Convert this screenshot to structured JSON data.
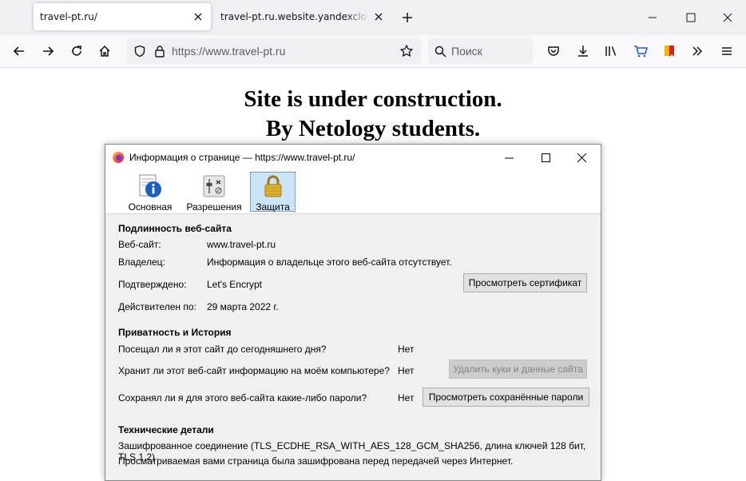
{
  "browser": {
    "tabs": [
      {
        "title": "travel-pt.ru/"
      },
      {
        "title": "travel-pt.ru.website.yandexcloud.net"
      }
    ],
    "url": "https://www.travel-pt.ru",
    "search_placeholder": "Поиск"
  },
  "page": {
    "line1": "Site is under construction.",
    "line2": "By Netology students."
  },
  "dialog": {
    "title": "Информация о странице — https://www.travel-pt.ru/",
    "tabs": [
      {
        "label": "Основная",
        "icon": "info-icon"
      },
      {
        "label": "Разрешения",
        "icon": "permissions-icon"
      },
      {
        "label": "Защита",
        "icon": "lock-icon",
        "selected": true
      }
    ],
    "identity": {
      "heading": "Подлинность веб-сайта",
      "website_label": "Веб-сайт:",
      "website_value": "www.travel-pt.ru",
      "owner_label": "Владелец:",
      "owner_value": "Информация о владельце этого веб-сайта отсутствует.",
      "verified_label": "Подтверждено:",
      "verified_value": "Let's Encrypt",
      "view_cert_button": "Просмотреть сертификат",
      "expires_label": "Действителен по:",
      "expires_value": "29 марта 2022 г."
    },
    "privacy": {
      "heading": "Приватность и История",
      "visited_question": "Посещал ли я этот сайт до сегодняшнего дня?",
      "visited_answer": "Нет",
      "storing_question": "Хранит ли этот веб-сайт информацию на моём компьютере?",
      "storing_answer": "Нет",
      "clear_cookies_button": "Удалить куки и данные сайта",
      "passwords_question": "Сохранял ли я для этого веб-сайта какие-либо пароли?",
      "passwords_answer": "Нет",
      "view_passwords_button": "Просмотреть сохранённые пароли"
    },
    "technical": {
      "heading": "Технические детали",
      "line1": "Зашифрованное соединение (TLS_ECDHE_RSA_WITH_AES_128_GCM_SHA256, длина ключей 128 бит, TLS 1.2)",
      "line2": "Просматриваемая вами страница была зашифрована перед передачей через Интернет."
    }
  },
  "colors": {
    "tabstrip_bg": "#f0f0f4",
    "dialog_bg": "#f0f0f0",
    "selected_tab_bg": "#cce4f7"
  }
}
